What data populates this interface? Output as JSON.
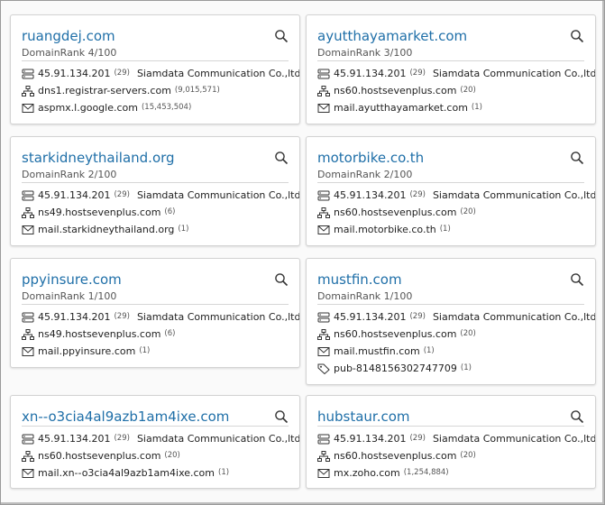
{
  "cards": [
    {
      "domain": "ruangdej.com",
      "rank": "DomainRank 4/100",
      "ip": "45.91.134.201",
      "ip_count": "(29)",
      "org": "Siamdata Communication Co.,ltd.",
      "ns": "dns1.registrar-servers.com",
      "ns_count": "(9,015,571)",
      "mx": "aspmx.l.google.com",
      "mx_count": "(15,453,504)"
    },
    {
      "domain": "ayutthayamarket.com",
      "rank": "DomainRank 3/100",
      "ip": "45.91.134.201",
      "ip_count": "(29)",
      "org": "Siamdata Communication Co.,ltd.",
      "ns": "ns60.hostsevenplus.com",
      "ns_count": "(20)",
      "mx": "mail.ayutthayamarket.com",
      "mx_count": "(1)"
    },
    {
      "domain": "starkidneythailand.org",
      "rank": "DomainRank 2/100",
      "ip": "45.91.134.201",
      "ip_count": "(29)",
      "org": "Siamdata Communication Co.,ltd.",
      "ns": "ns49.hostsevenplus.com",
      "ns_count": "(6)",
      "mx": "mail.starkidneythailand.org",
      "mx_count": "(1)"
    },
    {
      "domain": "motorbike.co.th",
      "rank": "DomainRank 2/100",
      "ip": "45.91.134.201",
      "ip_count": "(29)",
      "org": "Siamdata Communication Co.,ltd.",
      "ns": "ns60.hostsevenplus.com",
      "ns_count": "(20)",
      "mx": "mail.motorbike.co.th",
      "mx_count": "(1)"
    },
    {
      "domain": "ppyinsure.com",
      "rank": "DomainRank 1/100",
      "ip": "45.91.134.201",
      "ip_count": "(29)",
      "org": "Siamdata Communication Co.,ltd.",
      "ns": "ns49.hostsevenplus.com",
      "ns_count": "(6)",
      "mx": "mail.ppyinsure.com",
      "mx_count": "(1)"
    },
    {
      "domain": "mustfin.com",
      "rank": "DomainRank 1/100",
      "ip": "45.91.134.201",
      "ip_count": "(29)",
      "org": "Siamdata Communication Co.,ltd.",
      "ns": "ns60.hostsevenplus.com",
      "ns_count": "(20)",
      "mx": "mail.mustfin.com",
      "mx_count": "(1)",
      "pub": "pub-8148156302747709",
      "pub_count": "(1)"
    },
    {
      "domain": "xn--o3cia4al9azb1am4ixe.com",
      "ip": "45.91.134.201",
      "ip_count": "(29)",
      "org": "Siamdata Communication Co.,ltd.",
      "ns": "ns60.hostsevenplus.com",
      "ns_count": "(20)",
      "mx": "mail.xn--o3cia4al9azb1am4ixe.com",
      "mx_count": "(1)"
    },
    {
      "domain": "hubstaur.com",
      "ip": "45.91.134.201",
      "ip_count": "(29)",
      "org": "Siamdata Communication Co.,ltd.",
      "ns": "ns60.hostsevenplus.com",
      "ns_count": "(20)",
      "mx": "mx.zoho.com",
      "mx_count": "(1,254,884)"
    }
  ],
  "icons": {
    "search": "magnifier-icon",
    "ip": "server-icon",
    "ns": "sitemap-icon",
    "mx": "envelope-icon",
    "pub": "tag-icon",
    "flag": "thailand-flag-icon"
  },
  "colors": {
    "link": "#1f6fa8",
    "flag_red": "#d3162a",
    "flag_blue": "#2d2a6e"
  }
}
